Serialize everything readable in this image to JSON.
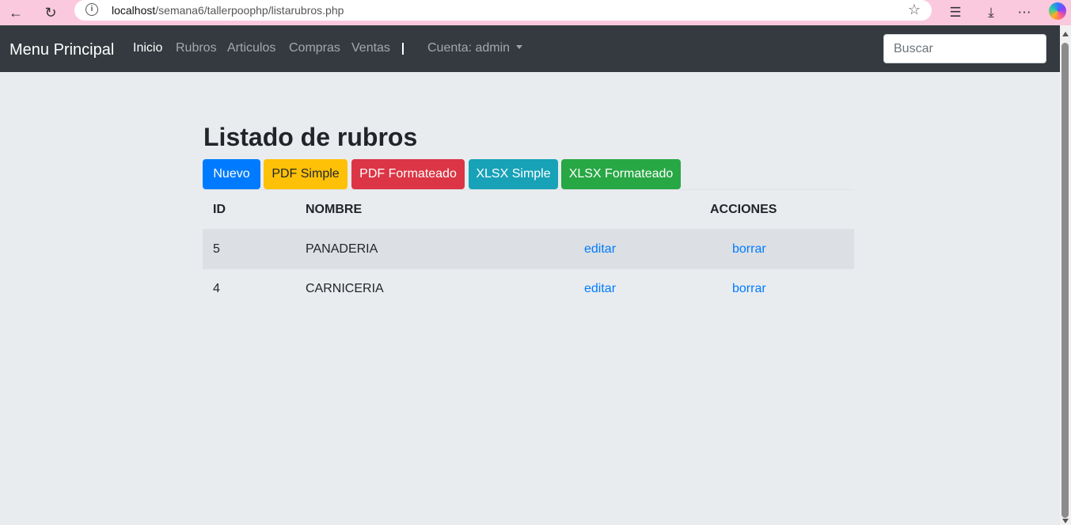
{
  "browser": {
    "url_host": "localhost",
    "url_path": "/semana6/tallerpoophp/listarubros.php"
  },
  "navbar": {
    "brand": "Menu Principal",
    "links": [
      "Inicio",
      "Rubros",
      "Articulos",
      "Compras",
      "Ventas"
    ],
    "account": "Cuenta: admin",
    "search_placeholder": "Buscar"
  },
  "page": {
    "title": "Listado de rubros",
    "buttons": {
      "nuevo": "Nuevo",
      "pdf_simple": "PDF Simple",
      "pdf_formateado": "PDF Formateado",
      "xlsx_simple": "XLSX Simple",
      "xlsx_formateado": "XLSX Formateado"
    }
  },
  "table": {
    "headers": {
      "id": "ID",
      "nombre": "NOMBRE",
      "acciones": "ACCIONES"
    },
    "rows": [
      {
        "id": "5",
        "nombre": "PANADERIA",
        "edit": "editar",
        "delete": "borrar"
      },
      {
        "id": "4",
        "nombre": "CARNICERIA",
        "edit": "editar",
        "delete": "borrar"
      }
    ]
  },
  "colors": {
    "navbar": "#343a40",
    "primary": "#007bff",
    "warning": "#ffc107",
    "danger": "#dc3545",
    "info": "#17a2b8",
    "success": "#28a745"
  }
}
